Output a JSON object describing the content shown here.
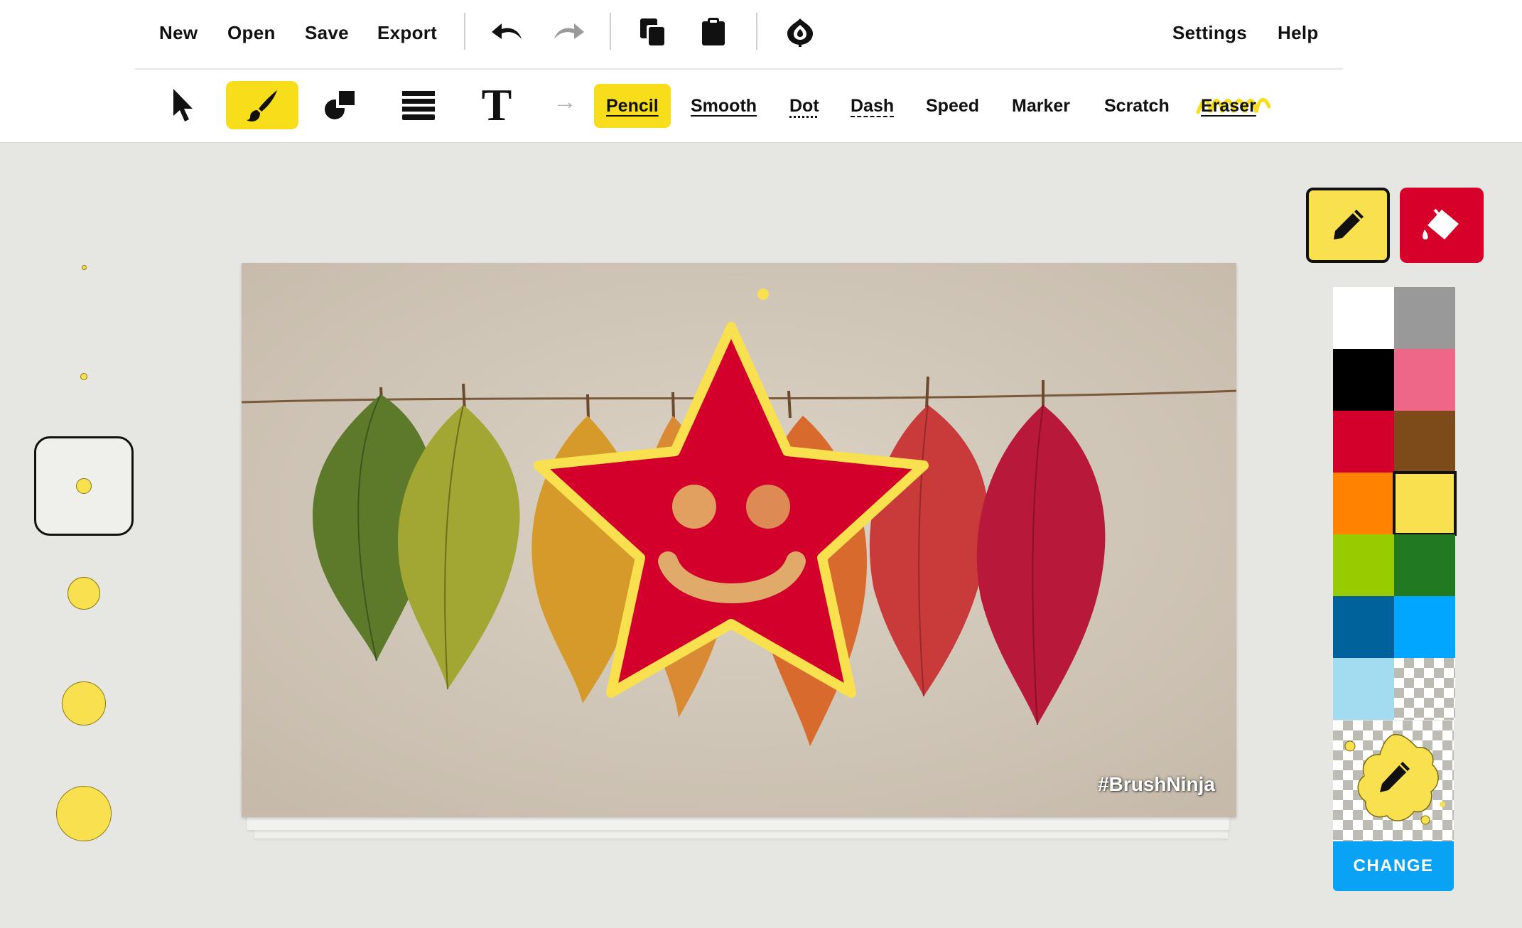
{
  "menu": {
    "new": "New",
    "open": "Open",
    "save": "Save",
    "export": "Export",
    "settings": "Settings",
    "help": "Help"
  },
  "icons": {
    "undo": "undo-icon",
    "redo": "redo-icon",
    "copy": "copy-icon",
    "paste": "paste-icon",
    "onion_skin": "onion-skin-icon",
    "select": "pointer-arrow-icon",
    "brush": "paintbrush-icon",
    "shapes": "shapes-icon",
    "layers": "layers-icon",
    "text": "text-icon",
    "arrow": "arrow-right-icon"
  },
  "toolbar": {
    "text_tool_glyph": "T",
    "arrow_glyph": "→",
    "brush_styles": [
      "Pencil",
      "Smooth",
      "Dot",
      "Dash",
      "Speed",
      "Marker",
      "Scratch",
      "Eraser"
    ],
    "active_brush_style": "Pencil",
    "active_tool": "brush"
  },
  "brush_sizes": {
    "count": 6,
    "selected_index": 2
  },
  "canvas": {
    "watermark": "#BrushNinja"
  },
  "color_panel": {
    "mode": "stroke",
    "swatches": [
      "#ffffff",
      "#999999",
      "#000000",
      "#ee6688",
      "#d2002b",
      "#7d4a1a",
      "#ff8200",
      "#f9e04f",
      "#99cc00",
      "#217a21",
      "#00629b",
      "#00a6ff",
      "#a3dbf1",
      "transparent"
    ],
    "selected_color": "#f9e04f",
    "change_label": "CHANGE"
  },
  "colors": {
    "accent": "#f7dd1a",
    "fill_red": "#d6002b",
    "star_red": "#d2002b",
    "star_outline": "#f9e04f",
    "change_blue": "#0aa2f5"
  }
}
